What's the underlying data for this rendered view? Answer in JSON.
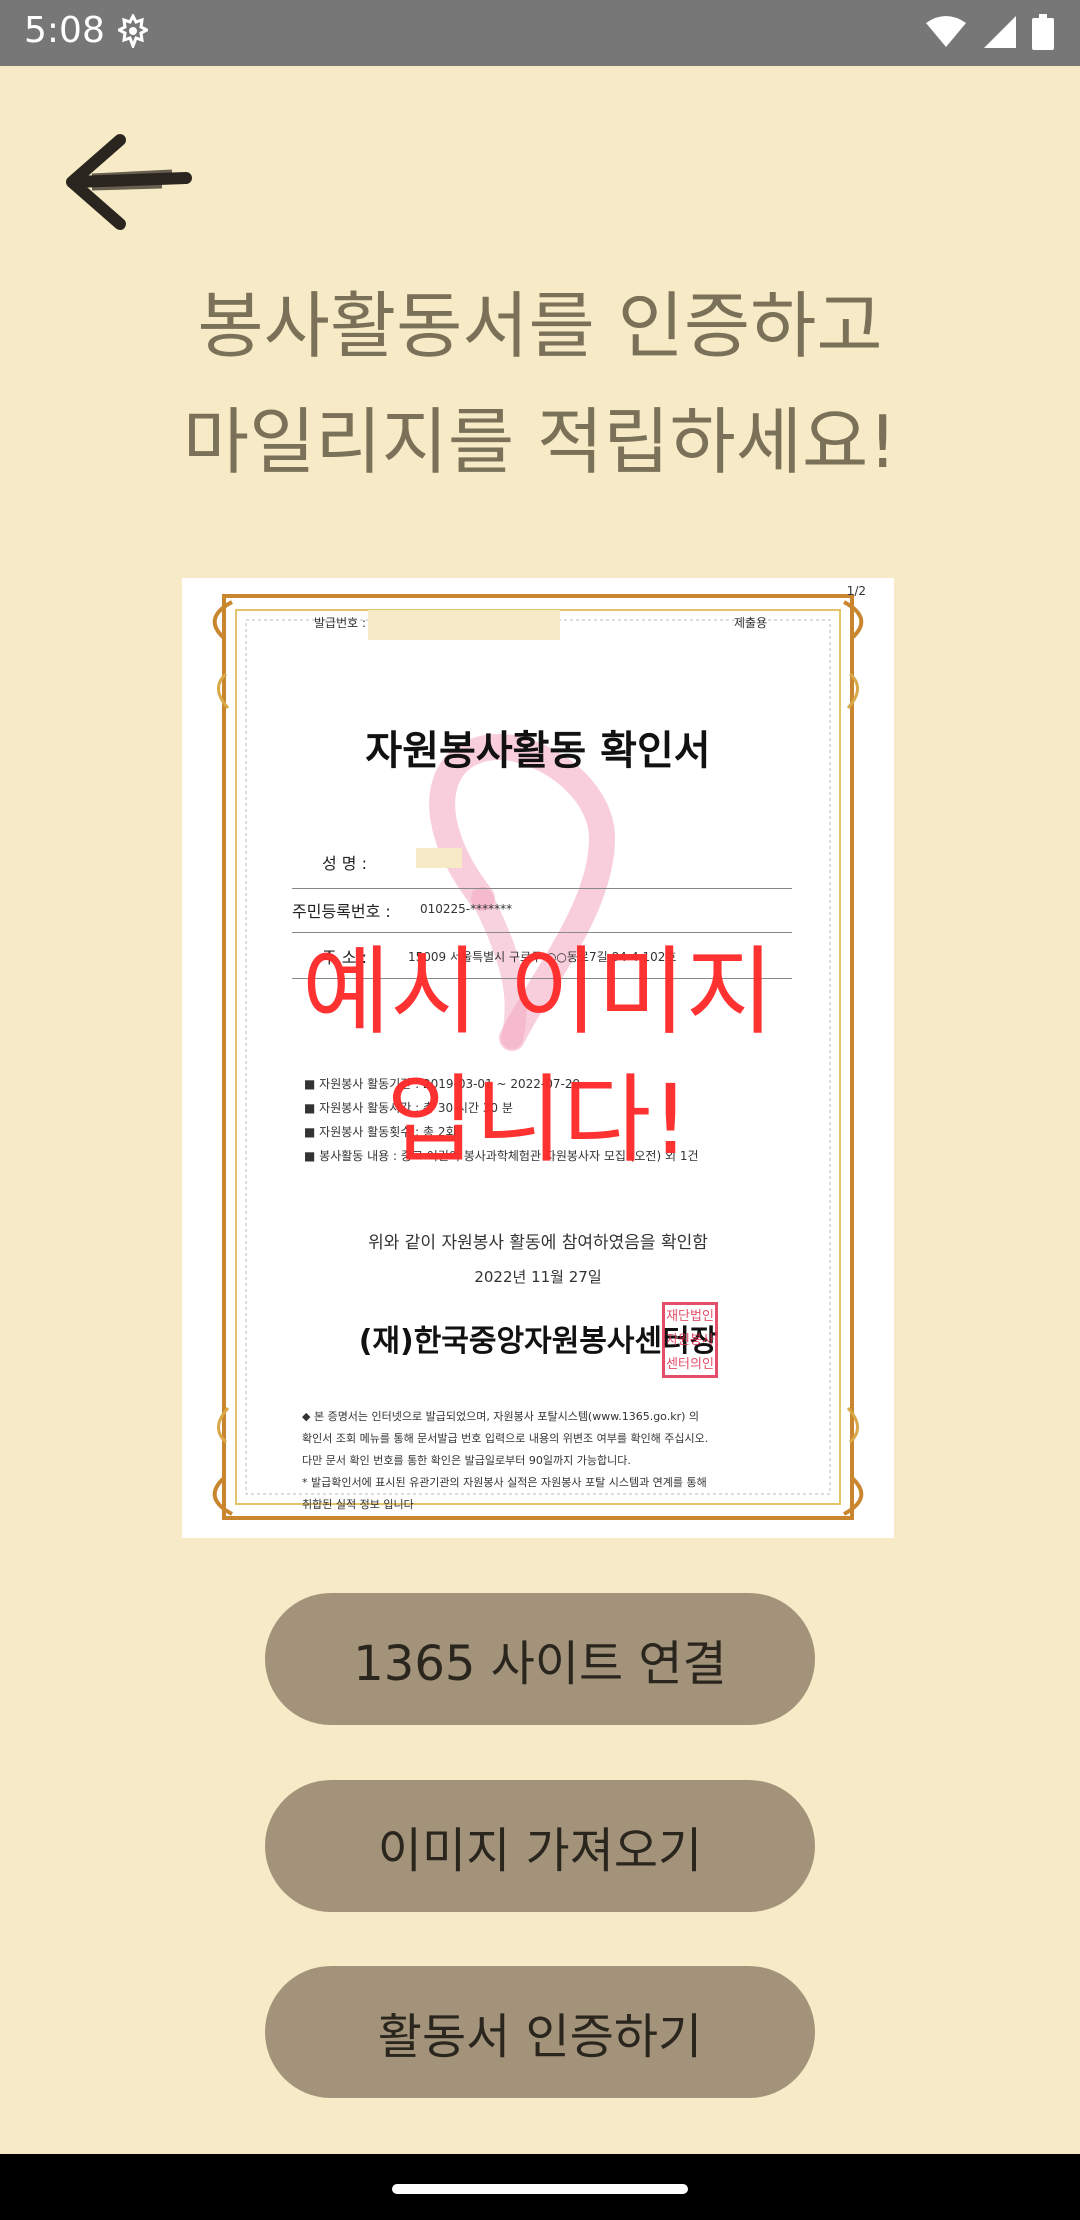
{
  "status_bar": {
    "time": "5:08",
    "icons": [
      "gear-icon",
      "wifi-icon",
      "signal-icon",
      "battery-icon"
    ]
  },
  "back": {
    "icon": "back-arrow-icon"
  },
  "headline": {
    "line1": "봉사활동서를 인증하고",
    "line2": "마일리지를 적립하세요!"
  },
  "certificate": {
    "page": "1/2",
    "issue_label": "발급번호 :",
    "submit_label": "제출용",
    "title": "자원봉사활동 확인서",
    "fields": {
      "name_label": "성     명 :",
      "rrn_label": "주민등록번호 :",
      "rrn_value": "010225-*******",
      "addr_label": "주     소 :",
      "addr_value": "15009 서울특별시 구로구 ○○동로7길 84-4 102호"
    },
    "bullets": [
      "■ 자원봉사 활동기간 : 2019-03-01 ~ 2022-07-29",
      "■ 자원봉사 활동시간 : 총 30 시간 30 분",
      "■ 자원봉사 활동횟수 : 총 2회",
      "■ 봉사활동 내용 :  중고 어린이 봉사과학체험관 자원봉사자 모집 (오전) 외 1건"
    ],
    "confirm_text": "위와 같이 자원봉사 활동에 참여하였음을 확인함",
    "date": "2022년 11월 27일",
    "issuer": "(재)한국중앙자원봉사센터장",
    "seal_text": [
      "재단법인",
      "자원봉사",
      "센터의인"
    ],
    "footnotes": [
      "◆ 본 증명서는 인터넷으로 발급되었으며, 자원봉사 포탈시스템(www.1365.go.kr) 의",
      "   확인서 조회 메뉴를 통해 문서발급 번호 입력으로 내용의 위변조 여부를 확인해 주십시오.",
      "   다만 문서 확인 번호를 통한 확인은 발급일로부터 90일까지 가능합니다.",
      "* 발급확인서에 표시된 유관기관의 자원봉사 실적은 자원봉사 포탈 시스템과 연계를 통해",
      "   취합된 실적 정보 입니다"
    ],
    "watermark_line1": "예시 이미지",
    "watermark_line2": "입니다!"
  },
  "buttons": {
    "site_link": "1365 사이트 연결",
    "import_image": "이미지 가져오기",
    "verify": "활동서 인증하기"
  },
  "colors": {
    "background": "#f6ebc6",
    "button": "#a3937b",
    "headline": "#7a7158",
    "watermark": "#ff2a2a"
  }
}
